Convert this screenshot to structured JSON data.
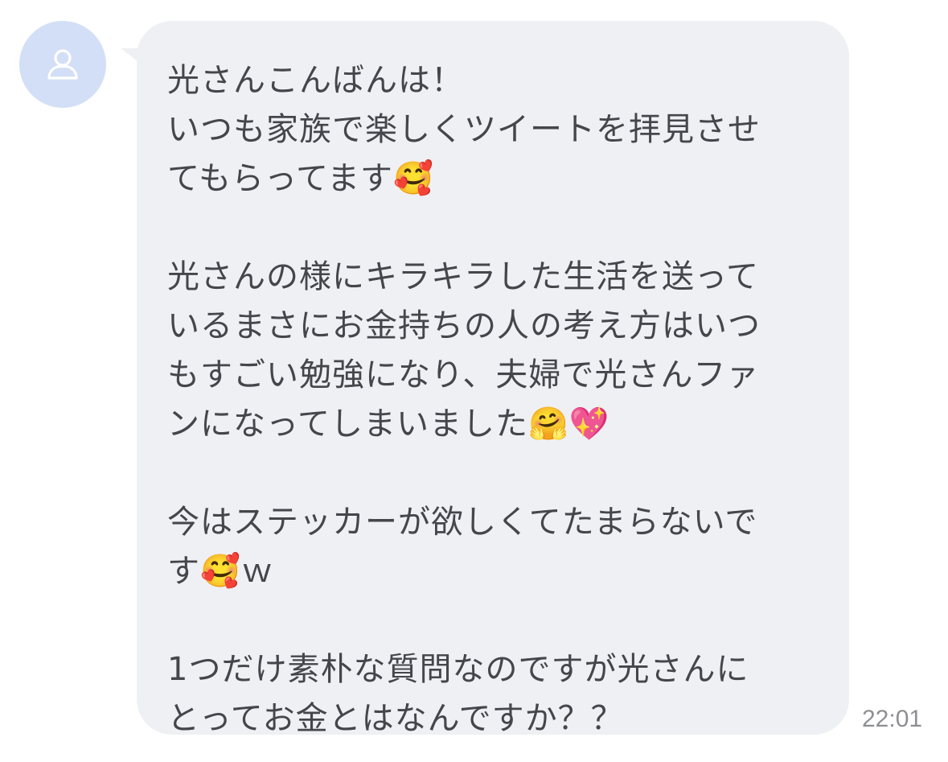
{
  "chat": {
    "avatar_icon": "person-outline-icon",
    "colors": {
      "avatar_bg": "#d3dff6",
      "avatar_icon": "#ffffff",
      "bubble_bg": "#eff0f3",
      "text": "#45464b",
      "timestamp": "#8e8f93"
    },
    "message": {
      "p1_line1": "光さんこんばんは！",
      "p1_line2": "いつも家族で楽しくツイートを拝見させ",
      "p1_line3": "てもらってます🥰",
      "p2_line1": "光さんの様にキラキラした生活を送って",
      "p2_line2": "いるまさにお金持ちの人の考え方はいつ",
      "p2_line3": "もすごい勉強になり、夫婦で光さんファ",
      "p2_line4": "ンになってしまいました🤗💖",
      "p3_line1": "今はステッカーが欲しくてたまらないで",
      "p3_line2": "す🥰ｗ",
      "p4_line1": "1つだけ素朴な質問なのですが光さんに",
      "p4_line2": "とってお金とはなんですか？？"
    },
    "timestamp": "22:01"
  }
}
